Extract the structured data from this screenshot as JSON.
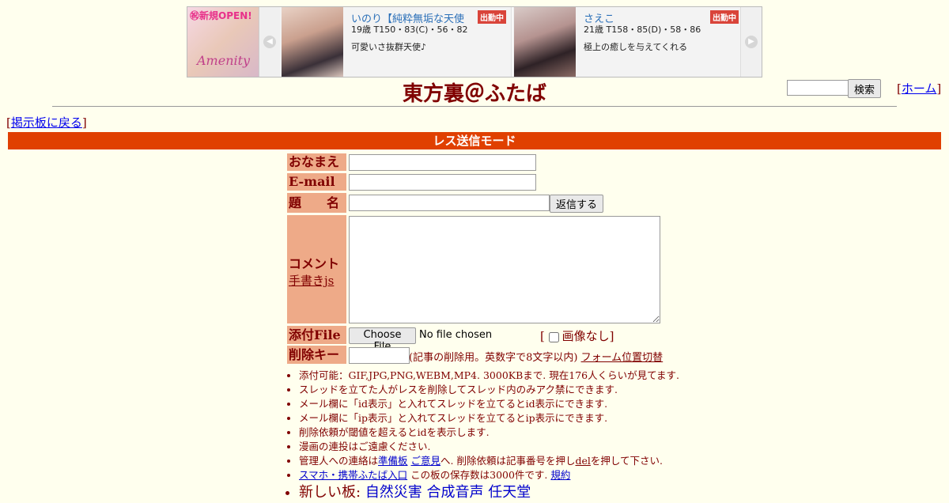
{
  "banner": {
    "promo_text": "㊗新規OPEN!",
    "promo_shop": "Amenity",
    "cards": [
      {
        "name": "いのり【純粋無垢な天使",
        "badge": "出勤中",
        "stats": "19歳 T150・83(C)・56・82",
        "desc": "可愛いさ抜群天使♪"
      },
      {
        "name": "さえこ",
        "badge": "出勤中",
        "stats": "21歳 T158・85(D)・58・86",
        "desc": "極上の癒しを与えてくれる"
      }
    ]
  },
  "header": {
    "title": "東方裏＠ふたば",
    "search_button": "検索",
    "home_link": "ホーム",
    "back_link": "掲示板に戻る"
  },
  "mode_bar": "レス送信モード",
  "form": {
    "name_label": "おなまえ",
    "email_label": "E-mail",
    "subject_label": "題　　名",
    "reply_button": "返信する",
    "comment_label": "コメント",
    "handwrite_link": "手書きjs",
    "file_label": "添付File",
    "file_button": "Choose File",
    "file_status": "No file chosen",
    "no_image_label": "画像なし",
    "delkey_label": "削除キー",
    "delkey_note": "(記事の削除用。英数字で8文字以内)",
    "form_position_link": "フォーム位置切替"
  },
  "notes": [
    "添付可能：GIF,JPG,PNG,WEBM,MP4. 3000KBまで. 現在176人くらいが見てます.",
    "スレッドを立てた人がレスを削除してスレッド内のみアク禁にできます.",
    "メール欄に「id表示」と入れてスレッドを立てるとid表示にできます.",
    "メール欄に「ip表示」と入れてスレッドを立てるとip表示にできます.",
    "削除依頼が閾値を超えるとidを表示します.",
    "漫画の連投はご遠慮ください."
  ],
  "contact": {
    "prefix": "管理人への連絡は",
    "link1": "準備板",
    "link2": "ご意見",
    "middle": "へ. 削除依頼は記事番号を押し",
    "del_link": "del",
    "suffix": "を押して下さい."
  },
  "mobile": {
    "link": "スマホ・携帯ふたば入口",
    "text": "この板の保存数は3000件です.",
    "rules_link": "規約"
  },
  "new_boards": {
    "label": "新しい板:",
    "boards": [
      "自然災害",
      "合成音声",
      "任天堂"
    ]
  }
}
